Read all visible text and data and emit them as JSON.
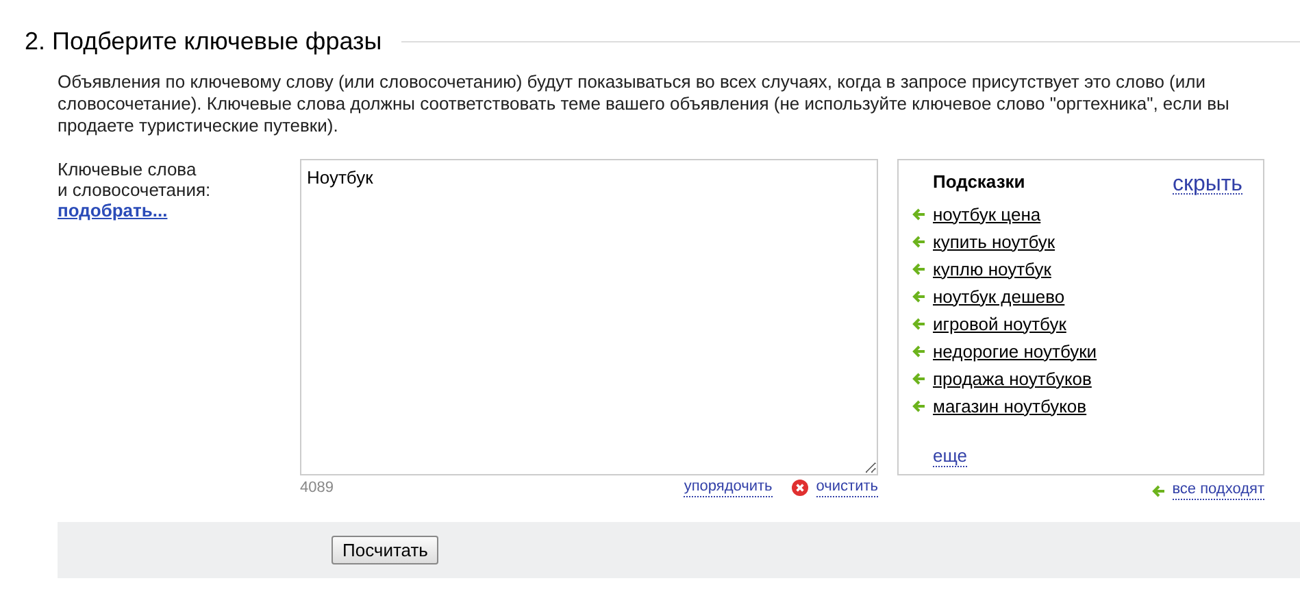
{
  "section": {
    "title": "2. Подберите ключевые фразы",
    "description": "Объявления по ключевому слову (или словосочетанию) будут показываться во всех случаях, когда в запросе присутствует это слово (или словосочетание). Ключевые слова должны соответствовать теме вашего объявления (не используйте ключевое слово \"оргтехника\", если вы продаете туристические путевки)."
  },
  "keywords": {
    "label_lines": [
      "Ключевые слова",
      "и словосочетания:"
    ],
    "pick_link": "подобрать...",
    "value": "Ноутбук",
    "counter": "4089",
    "sort_link": "упорядочить",
    "clear_link": "очистить"
  },
  "hints": {
    "title": "Подсказки",
    "hide_link": "скрыть",
    "items": [
      {
        "text": "ноутбук цена"
      },
      {
        "text": "купить ноутбук"
      },
      {
        "text": "куплю ноутбук"
      },
      {
        "text": "ноутбук дешево"
      },
      {
        "text": "игровой ноутбук"
      },
      {
        "text": "недорогие ноутбуки"
      },
      {
        "text": "продажа ноутбуков"
      },
      {
        "text": "магазин ноутбуков"
      }
    ],
    "more_link": "еще",
    "all_link": "все подходят"
  },
  "submit_button": "Посчитать"
}
